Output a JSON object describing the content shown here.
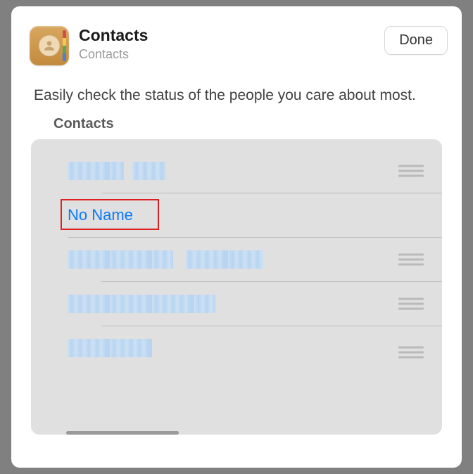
{
  "header": {
    "app_title": "Contacts",
    "app_subtitle": "Contacts",
    "done_label": "Done"
  },
  "description": "Easily check the status of the people you care about most.",
  "section_title": "Contacts",
  "contacts": [
    {
      "label": "",
      "redacted": true
    },
    {
      "label": "No Name",
      "redacted": false,
      "highlighted": true
    },
    {
      "label": "",
      "redacted": true
    },
    {
      "label": "",
      "redacted": true
    },
    {
      "label": "",
      "redacted": true
    }
  ],
  "colors": {
    "link": "#0a7aff",
    "highlight_border": "#e02020",
    "panel_bg": "#e0e0e0"
  }
}
